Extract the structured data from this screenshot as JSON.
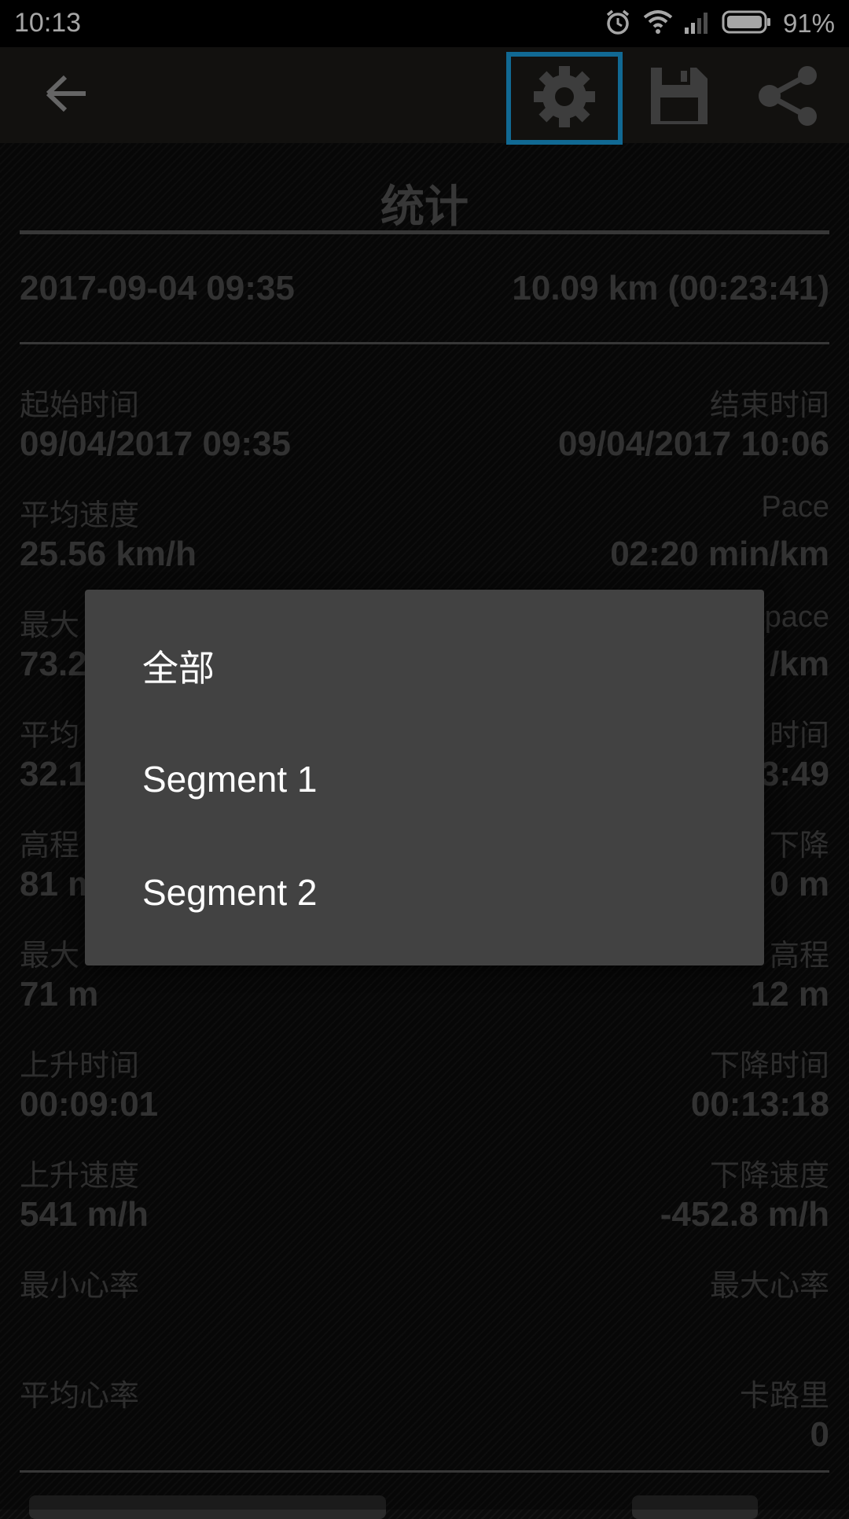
{
  "status_bar": {
    "time": "10:13",
    "battery": "91%",
    "icons": [
      "alarm-icon",
      "wifi-icon",
      "signal-icon",
      "battery-icon"
    ]
  },
  "toolbar": {
    "back_icon": "arrow-left-icon",
    "settings_icon": "gear-icon",
    "save_icon": "floppy-disk-icon",
    "share_icon": "share-icon",
    "highlight_color": "#1ba1e2"
  },
  "stats": {
    "title": "统计",
    "summary_date": "2017-09-04 09:35",
    "summary_distance": "10.09 km (00:23:41)",
    "rows": [
      {
        "left_label": "起始时间",
        "left_value": "09/04/2017 09:35",
        "right_label": "结束时间",
        "right_value": "09/04/2017 10:06"
      },
      {
        "left_label": "平均速度",
        "left_value": "25.56 km/h",
        "right_label": "Pace",
        "right_value": "02:20 min/km"
      },
      {
        "left_label": "最大",
        "left_value": "73.2",
        "right_label": "pace",
        "right_value": "/km"
      },
      {
        "left_label": "平均",
        "left_value": "32.1",
        "right_label": "时间",
        "right_value": "3:49"
      },
      {
        "left_label": "高程",
        "left_value": "81 m",
        "right_label": "下降",
        "right_value": "0 m"
      },
      {
        "left_label": "最大",
        "left_value": "71 m",
        "right_label": "高程",
        "right_value": "12 m"
      },
      {
        "left_label": "上升时间",
        "left_value": "00:09:01",
        "right_label": "下降时间",
        "right_value": "00:13:18"
      },
      {
        "left_label": "上升速度",
        "left_value": "541 m/h",
        "right_label": "下降速度",
        "right_value": "-452.8 m/h"
      },
      {
        "left_label": "最小心率",
        "left_value": "",
        "right_label": "最大心率",
        "right_value": ""
      },
      {
        "left_label": "平均心率",
        "left_value": "",
        "right_label": "卡路里",
        "right_value": "0"
      }
    ]
  },
  "dialog": {
    "options": [
      "全部",
      "Segment 1",
      "Segment 2"
    ]
  }
}
